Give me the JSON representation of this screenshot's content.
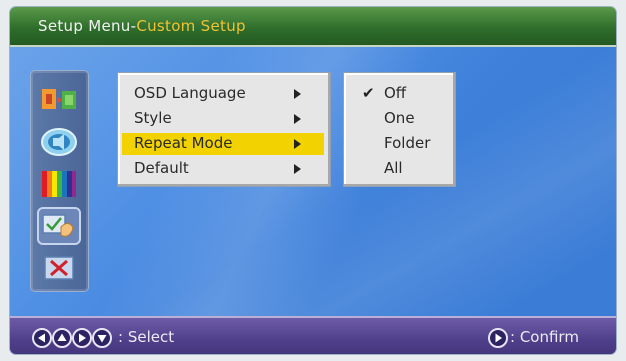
{
  "header": {
    "title": "Setup Menu-",
    "subtitle": "Custom Setup"
  },
  "sidebar": {
    "icons": [
      {
        "name": "general-setup-icon",
        "selected": false
      },
      {
        "name": "speaker-audio-icon",
        "selected": false
      },
      {
        "name": "video-color-bars-icon",
        "selected": false
      },
      {
        "name": "custom-setup-checklist-icon",
        "selected": true
      },
      {
        "name": "exit-icon",
        "selected": false
      }
    ]
  },
  "menu": {
    "items": [
      {
        "label": "OSD Language",
        "highlighted": false
      },
      {
        "label": "Style",
        "highlighted": false
      },
      {
        "label": "Repeat Mode",
        "highlighted": true
      },
      {
        "label": "Default",
        "highlighted": false
      }
    ]
  },
  "submenu": {
    "checkmark": "✔",
    "options": [
      {
        "label": "Off",
        "checked": true
      },
      {
        "label": "One",
        "checked": false
      },
      {
        "label": "Folder",
        "checked": false
      },
      {
        "label": "All",
        "checked": false
      }
    ]
  },
  "footer": {
    "select_text": ": Select",
    "confirm_text": ": Confirm",
    "nav_keys": [
      "left-arrow-key-icon",
      "up-arrow-key-icon",
      "right-arrow-key-icon",
      "down-arrow-key-icon"
    ],
    "confirm_key": "play-confirm-key-icon"
  },
  "colors": {
    "title_bar": "#2f6e2c",
    "subtitle": "#f2c233",
    "highlight": "#f2d200",
    "background": "#4f8fe4",
    "footer": "#4f3f8a"
  }
}
